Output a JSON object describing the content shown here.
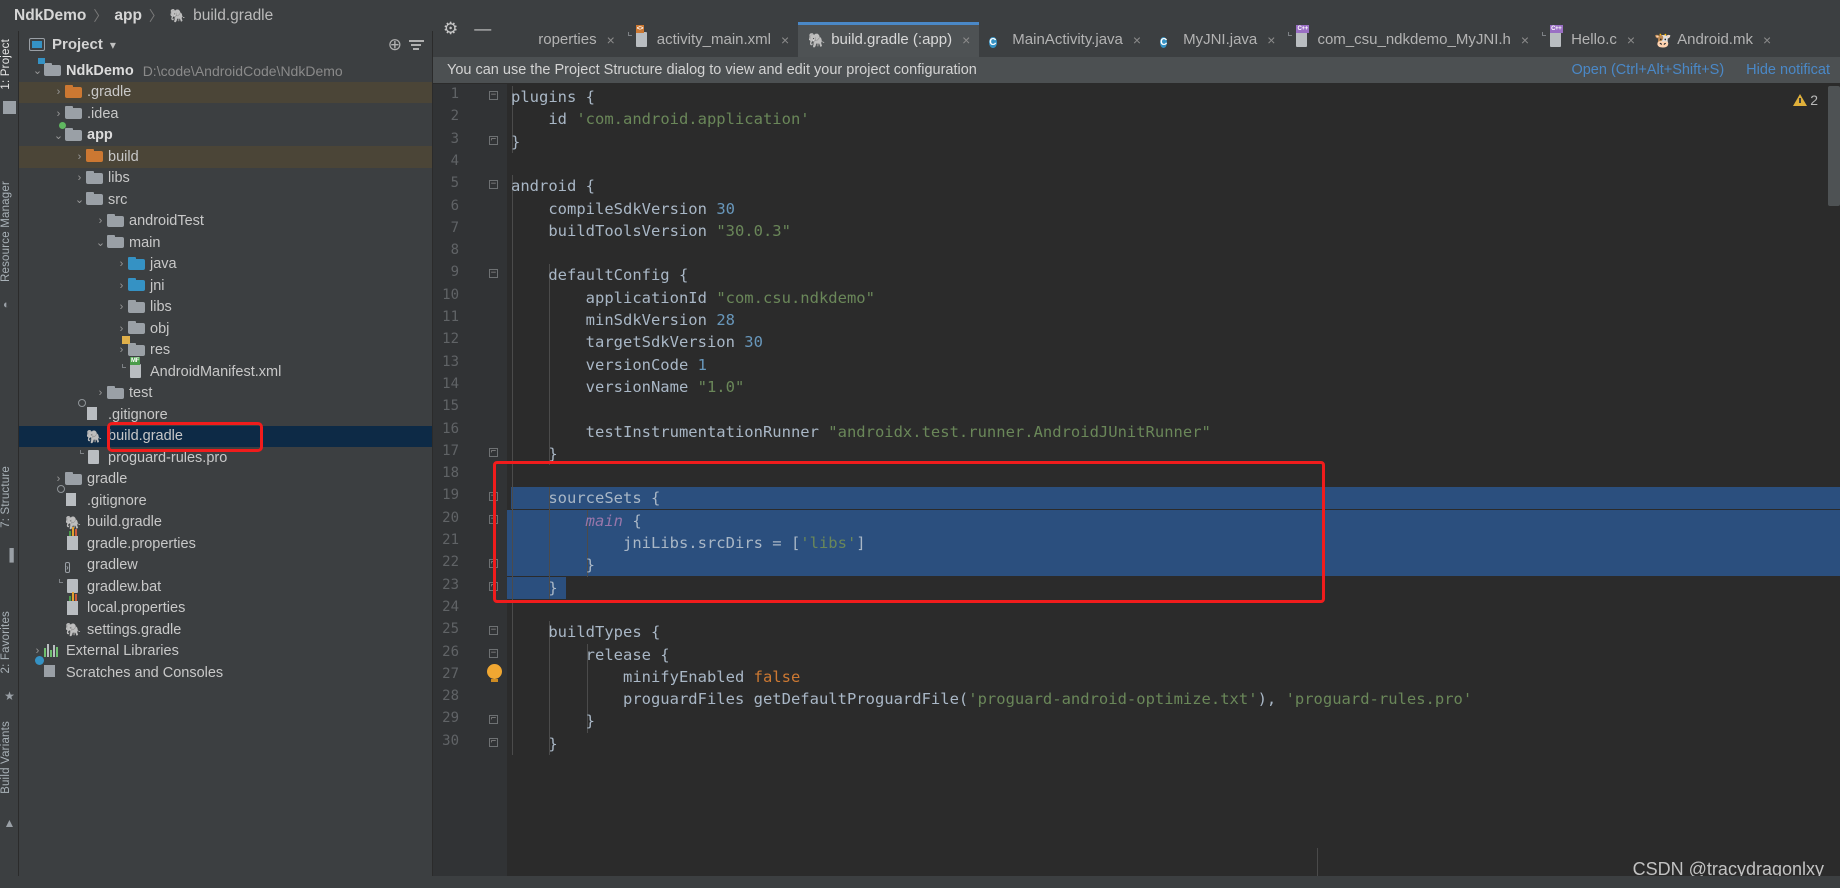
{
  "window": {
    "breadcrumb": [
      {
        "label": "NdkDemo",
        "bold": true
      },
      {
        "label": "app",
        "bold": true
      },
      {
        "label": "build.gradle",
        "bold": false,
        "icon": "gradle-icon"
      }
    ],
    "separator": "〉",
    "watermark": "CSDN @tracydragonlxy"
  },
  "left_strip": {
    "top_tabs": [
      {
        "label": "1: Project",
        "selected": true,
        "icon": "project-icon"
      },
      {
        "label": "Resource Manager",
        "selected": false,
        "icon": "resource-manager-icon"
      }
    ],
    "bottom_tabs": [
      {
        "label": "7: Structure",
        "selected": false,
        "icon": "structure-icon"
      },
      {
        "label": "2: Favorites",
        "selected": false,
        "icon": "star-icon"
      },
      {
        "label": "Build Variants",
        "selected": false,
        "icon": "android-icon"
      }
    ]
  },
  "project_panel": {
    "title": "Project",
    "dropdown_arrow": "▾",
    "actions": [
      {
        "name": "locate-icon",
        "glyph": "⊕"
      },
      {
        "name": "collapse-all-icon",
        "glyph": "≡"
      }
    ],
    "tree": [
      {
        "depth": 0,
        "twist": "⌄",
        "icon": "folder-module",
        "label": "NdkDemo",
        "bold": true,
        "path": "D:\\code\\AndroidCode\\NdkDemo",
        "state": "normal"
      },
      {
        "depth": 1,
        "twist": "›",
        "icon": "folder-orange",
        "label": ".gradle",
        "bold": false,
        "path": "",
        "state": "excluded"
      },
      {
        "depth": 1,
        "twist": "›",
        "icon": "folder",
        "label": ".idea",
        "bold": false,
        "path": "",
        "state": "normal"
      },
      {
        "depth": 1,
        "twist": "⌄",
        "icon": "folder-module-green",
        "label": "app",
        "bold": true,
        "path": "",
        "state": "normal"
      },
      {
        "depth": 2,
        "twist": "›",
        "icon": "folder-orange",
        "label": "build",
        "bold": false,
        "path": "",
        "state": "excluded"
      },
      {
        "depth": 2,
        "twist": "›",
        "icon": "folder",
        "label": "libs",
        "bold": false,
        "path": "",
        "state": "normal"
      },
      {
        "depth": 2,
        "twist": "⌄",
        "icon": "folder",
        "label": "src",
        "bold": false,
        "path": "",
        "state": "normal"
      },
      {
        "depth": 3,
        "twist": "›",
        "icon": "folder",
        "label": "androidTest",
        "bold": false,
        "path": "",
        "state": "normal"
      },
      {
        "depth": 3,
        "twist": "⌄",
        "icon": "folder",
        "label": "main",
        "bold": false,
        "path": "",
        "state": "normal"
      },
      {
        "depth": 4,
        "twist": "›",
        "icon": "folder-blue",
        "label": "java",
        "bold": false,
        "path": "",
        "state": "normal"
      },
      {
        "depth": 4,
        "twist": "›",
        "icon": "folder-blue",
        "label": "jni",
        "bold": false,
        "path": "",
        "state": "normal"
      },
      {
        "depth": 4,
        "twist": "›",
        "icon": "folder",
        "label": "libs",
        "bold": false,
        "path": "",
        "state": "normal"
      },
      {
        "depth": 4,
        "twist": "›",
        "icon": "folder",
        "label": "obj",
        "bold": false,
        "path": "",
        "state": "normal"
      },
      {
        "depth": 4,
        "twist": "›",
        "icon": "folder-res",
        "label": "res",
        "bold": false,
        "path": "",
        "state": "normal"
      },
      {
        "depth": 4,
        "twist": "",
        "icon": "manifest-file",
        "label": "AndroidManifest.xml",
        "bold": false,
        "path": "",
        "state": "normal"
      },
      {
        "depth": 3,
        "twist": "›",
        "icon": "folder",
        "label": "test",
        "bold": false,
        "path": "",
        "state": "normal"
      },
      {
        "depth": 2,
        "twist": "",
        "icon": "gitignore-file",
        "label": ".gitignore",
        "bold": false,
        "path": "",
        "state": "normal"
      },
      {
        "depth": 2,
        "twist": "",
        "icon": "gradle-file",
        "label": "build.gradle",
        "bold": false,
        "path": "",
        "state": "selected"
      },
      {
        "depth": 2,
        "twist": "",
        "icon": "text-file",
        "label": "proguard-rules.pro",
        "bold": false,
        "path": "",
        "state": "normal"
      },
      {
        "depth": 1,
        "twist": "›",
        "icon": "folder",
        "label": "gradle",
        "bold": false,
        "path": "",
        "state": "normal"
      },
      {
        "depth": 1,
        "twist": "",
        "icon": "gitignore-file",
        "label": ".gitignore",
        "bold": false,
        "path": "",
        "state": "normal"
      },
      {
        "depth": 1,
        "twist": "",
        "icon": "gradle-file",
        "label": "build.gradle",
        "bold": false,
        "path": "",
        "state": "normal"
      },
      {
        "depth": 1,
        "twist": "",
        "icon": "properties-file",
        "label": "gradle.properties",
        "bold": false,
        "path": "",
        "state": "normal"
      },
      {
        "depth": 1,
        "twist": "",
        "icon": "shell-file",
        "label": "gradlew",
        "bold": false,
        "path": "",
        "state": "normal"
      },
      {
        "depth": 1,
        "twist": "",
        "icon": "text-file",
        "label": "gradlew.bat",
        "bold": false,
        "path": "",
        "state": "normal"
      },
      {
        "depth": 1,
        "twist": "",
        "icon": "properties-file",
        "label": "local.properties",
        "bold": false,
        "path": "",
        "state": "normal"
      },
      {
        "depth": 1,
        "twist": "",
        "icon": "gradle-file",
        "label": "settings.gradle",
        "bold": false,
        "path": "",
        "state": "normal"
      },
      {
        "depth": 0,
        "twist": "›",
        "icon": "external-libraries",
        "label": "External Libraries",
        "bold": false,
        "path": "",
        "state": "normal"
      },
      {
        "depth": 0,
        "twist": "",
        "icon": "scratches",
        "label": "Scratches and Consoles",
        "bold": false,
        "path": "",
        "state": "normal"
      }
    ],
    "annotation_color": "#f01c1c"
  },
  "toolbar_actions": [
    {
      "name": "settings-gear-icon",
      "glyph": "⚙"
    },
    {
      "name": "minimize-icon",
      "glyph": "—"
    }
  ],
  "tabs": [
    {
      "label": "roperties",
      "icon": "properties-icon",
      "active": false,
      "close": "×"
    },
    {
      "label": "activity_main.xml",
      "icon": "xml-layout-icon",
      "active": false,
      "close": "×"
    },
    {
      "label": "build.gradle (:app)",
      "icon": "gradle-icon",
      "active": true,
      "close": "×"
    },
    {
      "label": "MainActivity.java",
      "icon": "java-class-icon",
      "active": false,
      "close": "×"
    },
    {
      "label": "MyJNI.java",
      "icon": "java-class-icon",
      "active": false,
      "close": "×"
    },
    {
      "label": "com_csu_ndkdemo_MyJNI.h",
      "icon": "cpp-header-icon",
      "active": false,
      "close": "×"
    },
    {
      "label": "Hello.c",
      "icon": "cpp-header-icon",
      "active": false,
      "close": "×"
    },
    {
      "label": "Android.mk",
      "icon": "makefile-icon",
      "active": false,
      "close": "×"
    }
  ],
  "notification": {
    "message": "You can use the Project Structure dialog to view and edit your project configuration",
    "open_link": "Open (Ctrl+Alt+Shift+S)",
    "hide_link": "Hide notificat"
  },
  "inspection": {
    "warning_count": "2",
    "icon": "warning-triangle-icon"
  },
  "editor": {
    "language": "groovy",
    "selection_color": "#2b4f7e",
    "annotation_color": "#f01c1c",
    "lines": [
      {
        "n": "1",
        "fold": "minus",
        "indent": 0,
        "tokens": [
          {
            "t": "plugins {",
            "c": "pl"
          }
        ]
      },
      {
        "n": "2",
        "fold": "",
        "indent": 0,
        "tokens": [
          {
            "t": "    id ",
            "c": "pl"
          },
          {
            "t": "'com.android.application'",
            "c": "str"
          }
        ]
      },
      {
        "n": "3",
        "fold": "end",
        "indent": 0,
        "tokens": [
          {
            "t": "}",
            "c": "pl"
          }
        ]
      },
      {
        "n": "4",
        "fold": "",
        "indent": 0,
        "tokens": []
      },
      {
        "n": "5",
        "fold": "minus",
        "indent": 0,
        "tokens": [
          {
            "t": "android {",
            "c": "pl"
          }
        ]
      },
      {
        "n": "6",
        "fold": "",
        "indent": 0,
        "tokens": [
          {
            "t": "    compileSdkVersion ",
            "c": "pl"
          },
          {
            "t": "30",
            "c": "num"
          }
        ]
      },
      {
        "n": "7",
        "fold": "",
        "indent": 0,
        "tokens": [
          {
            "t": "    buildToolsVersion ",
            "c": "pl"
          },
          {
            "t": "\"30.0.3\"",
            "c": "str"
          }
        ]
      },
      {
        "n": "8",
        "fold": "",
        "indent": 0,
        "tokens": []
      },
      {
        "n": "9",
        "fold": "minus",
        "indent": 0,
        "tokens": [
          {
            "t": "    defaultConfig {",
            "c": "pl"
          }
        ]
      },
      {
        "n": "10",
        "fold": "",
        "indent": 0,
        "tokens": [
          {
            "t": "        applicationId ",
            "c": "pl"
          },
          {
            "t": "\"com.csu.ndkdemo\"",
            "c": "str"
          }
        ]
      },
      {
        "n": "11",
        "fold": "",
        "indent": 0,
        "tokens": [
          {
            "t": "        minSdkVersion ",
            "c": "pl"
          },
          {
            "t": "28",
            "c": "num"
          }
        ]
      },
      {
        "n": "12",
        "fold": "",
        "indent": 0,
        "tokens": [
          {
            "t": "        targetSdkVersion ",
            "c": "pl"
          },
          {
            "t": "30",
            "c": "num"
          }
        ]
      },
      {
        "n": "13",
        "fold": "",
        "indent": 0,
        "tokens": [
          {
            "t": "        versionCode ",
            "c": "pl"
          },
          {
            "t": "1",
            "c": "num"
          }
        ]
      },
      {
        "n": "14",
        "fold": "",
        "indent": 0,
        "tokens": [
          {
            "t": "        versionName ",
            "c": "pl"
          },
          {
            "t": "\"1.0\"",
            "c": "str"
          }
        ]
      },
      {
        "n": "15",
        "fold": "",
        "indent": 0,
        "tokens": []
      },
      {
        "n": "16",
        "fold": "",
        "indent": 0,
        "tokens": [
          {
            "t": "        testInstrumentationRunner ",
            "c": "pl"
          },
          {
            "t": "\"androidx.test.runner.AndroidJUnitRunner\"",
            "c": "str"
          }
        ]
      },
      {
        "n": "17",
        "fold": "end",
        "indent": 0,
        "tokens": [
          {
            "t": "    }",
            "c": "pl"
          }
        ]
      },
      {
        "n": "18",
        "fold": "",
        "indent": 0,
        "tokens": []
      },
      {
        "n": "19",
        "fold": "minus",
        "indent": 0,
        "tokens": [
          {
            "t": "    sourceSets {",
            "c": "pl"
          }
        ]
      },
      {
        "n": "20",
        "fold": "minus",
        "indent": 0,
        "tokens": [
          {
            "t": "        ",
            "c": "pl"
          },
          {
            "t": "main",
            "c": "ital"
          },
          {
            "t": " {",
            "c": "pl"
          }
        ]
      },
      {
        "n": "21",
        "fold": "",
        "indent": 0,
        "tokens": [
          {
            "t": "            jniLibs.srcDirs = [",
            "c": "pl"
          },
          {
            "t": "'libs'",
            "c": "str"
          },
          {
            "t": "]",
            "c": "pl"
          }
        ]
      },
      {
        "n": "22",
        "fold": "end",
        "indent": 0,
        "tokens": [
          {
            "t": "        }",
            "c": "pl"
          }
        ]
      },
      {
        "n": "23",
        "fold": "end",
        "indent": 0,
        "tokens": [
          {
            "t": "    }",
            "c": "pl"
          }
        ]
      },
      {
        "n": "24",
        "fold": "",
        "indent": 0,
        "tokens": []
      },
      {
        "n": "25",
        "fold": "minus",
        "indent": 0,
        "tokens": [
          {
            "t": "    buildTypes {",
            "c": "pl"
          }
        ]
      },
      {
        "n": "26",
        "fold": "minus",
        "indent": 0,
        "tokens": [
          {
            "t": "        release {",
            "c": "pl"
          }
        ]
      },
      {
        "n": "27",
        "fold": "",
        "indent": 0,
        "tokens": [
          {
            "t": "            minifyEnabled ",
            "c": "pl"
          },
          {
            "t": "false",
            "c": "kw"
          }
        ]
      },
      {
        "n": "28",
        "fold": "",
        "indent": 0,
        "tokens": [
          {
            "t": "            proguardFiles getDefaultProguardFile(",
            "c": "pl"
          },
          {
            "t": "'proguard-android-optimize.txt'",
            "c": "str"
          },
          {
            "t": "), ",
            "c": "pl"
          },
          {
            "t": "'proguard-rules.pro'",
            "c": "str"
          }
        ]
      },
      {
        "n": "29",
        "fold": "end",
        "indent": 0,
        "tokens": [
          {
            "t": "        }",
            "c": "pl"
          }
        ]
      },
      {
        "n": "30",
        "fold": "end",
        "indent": 0,
        "tokens": [
          {
            "t": "    }",
            "c": "pl"
          }
        ]
      }
    ],
    "selected_lines": [
      19,
      20,
      21,
      22,
      23
    ],
    "bulb_line": 23
  }
}
